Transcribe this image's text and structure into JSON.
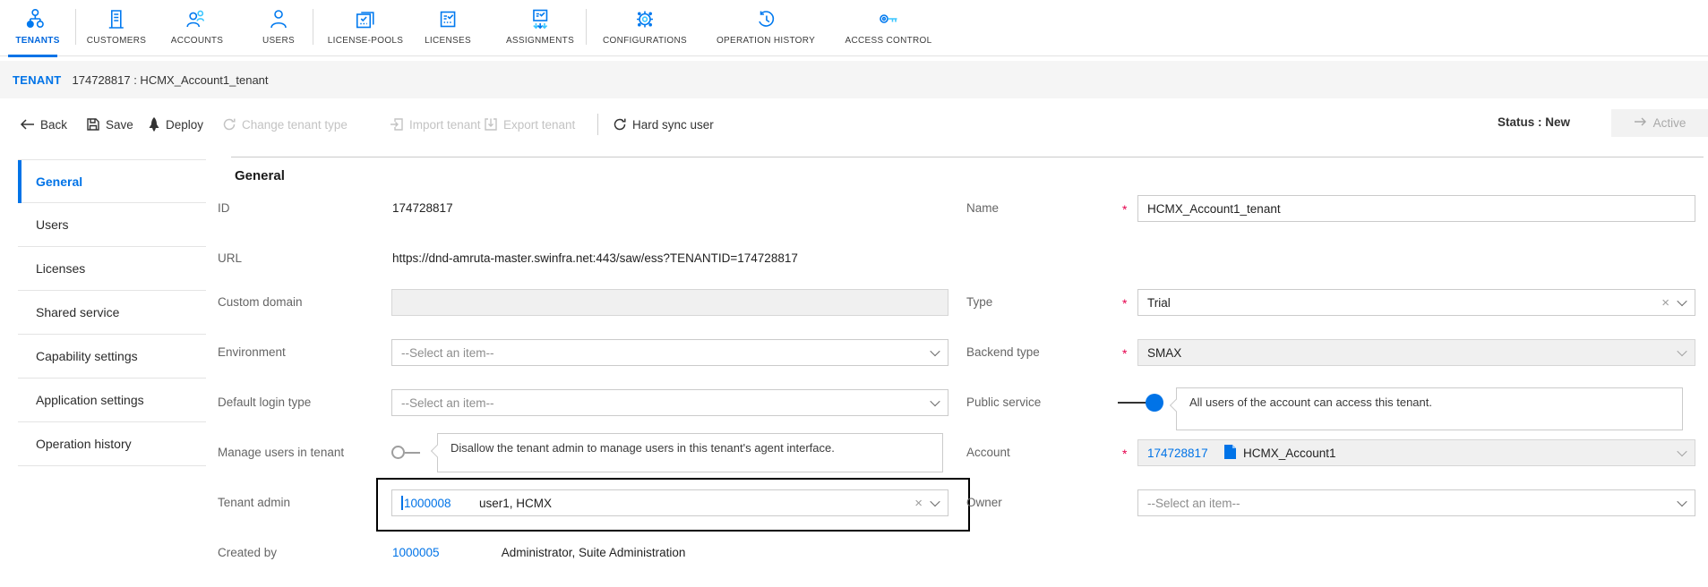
{
  "colors": {
    "accent_blue": "#0073e7",
    "icon_blue": "#0079ef",
    "icon_cyan": "#3bc6ff",
    "required_red": "#e5004c",
    "disabled_bg": "#f0f0f0"
  },
  "nav": {
    "items": [
      {
        "label": "TENANTS",
        "active": true
      },
      {
        "label": "CUSTOMERS"
      },
      {
        "label": "ACCOUNTS"
      },
      {
        "label": "USERS"
      },
      {
        "label": "LICENSE-POOLS"
      },
      {
        "label": "LICENSES"
      },
      {
        "label": "ASSIGNMENTS"
      },
      {
        "label": "CONFIGURATIONS"
      },
      {
        "label": "OPERATION HISTORY"
      },
      {
        "label": "ACCESS CONTROL"
      }
    ]
  },
  "tenant_bar": {
    "label": "TENANT",
    "value": "174728817 : HCMX_Account1_tenant"
  },
  "toolbar": {
    "back": "Back",
    "save": "Save",
    "deploy": "Deploy",
    "change_tenant_type": "Change tenant type",
    "import_tenant": "Import tenant",
    "export_tenant": "Export tenant",
    "hard_sync_user": "Hard sync user",
    "status_label": "Status : New",
    "active_button": "Active"
  },
  "sidebar": {
    "items": [
      {
        "label": "General",
        "active": true
      },
      {
        "label": "Users"
      },
      {
        "label": "Licenses"
      },
      {
        "label": "Shared service"
      },
      {
        "label": "Capability settings"
      },
      {
        "label": "Application settings"
      },
      {
        "label": "Operation history"
      }
    ]
  },
  "form": {
    "heading": "General",
    "left": {
      "id": {
        "label": "ID",
        "value": "174728817"
      },
      "url": {
        "label": "URL",
        "value": "https://dnd-amruta-master.swinfra.net:443/saw/ess?TENANTID=174728817"
      },
      "custom_domain": {
        "label": "Custom domain",
        "value": ""
      },
      "environment": {
        "label": "Environment",
        "placeholder": "--Select an item--"
      },
      "default_login_type": {
        "label": "Default login type",
        "placeholder": "--Select an item--"
      },
      "manage_users": {
        "label": "Manage users in tenant",
        "toggle": "off",
        "tooltip": "Disallow the tenant admin to manage users in this tenant's agent interface."
      },
      "tenant_admin": {
        "label": "Tenant admin",
        "id_value": "1000008",
        "name_value": "user1, HCMX"
      },
      "created_by": {
        "label": "Created by",
        "id_value": "1000005",
        "name_value": "Administrator, Suite Administration"
      }
    },
    "right": {
      "name": {
        "label": "Name",
        "required": "*",
        "value": "HCMX_Account1_tenant"
      },
      "type": {
        "label": "Type",
        "required": "*",
        "value": "Trial"
      },
      "backend_type": {
        "label": "Backend type",
        "required": "*",
        "value": "SMAX"
      },
      "public_service": {
        "label": "Public service",
        "toggle": "on",
        "tooltip": "All users of the account can access this tenant."
      },
      "account": {
        "label": "Account",
        "required": "*",
        "id_value": "174728817",
        "name_value": "HCMX_Account1"
      },
      "owner": {
        "label": "Owner",
        "placeholder": "--Select an item--"
      }
    }
  }
}
